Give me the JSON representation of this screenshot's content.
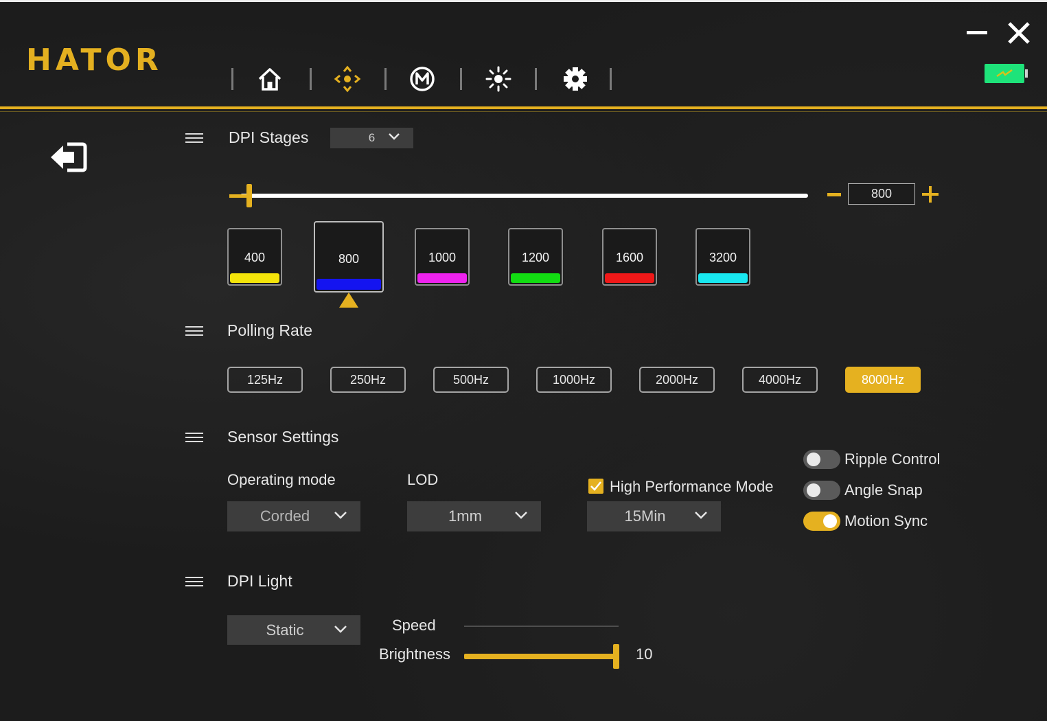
{
  "brand": {
    "logo_text": "HATOR",
    "accent_color": "#e5b120"
  },
  "nav": {
    "tabs": [
      {
        "name": "home",
        "icon": "home-icon"
      },
      {
        "name": "buttons",
        "icon": "crosshair-arrows-icon",
        "active": true
      },
      {
        "name": "macros",
        "icon": "m-circle-icon"
      },
      {
        "name": "lighting",
        "icon": "sun-icon"
      },
      {
        "name": "settings",
        "icon": "gear-icon"
      }
    ]
  },
  "window": {
    "minimize_icon": "minimize-icon",
    "close_icon": "close-icon",
    "battery_icon": "battery-charging-icon"
  },
  "dpi": {
    "title": "DPI Stages",
    "stages_count": "6",
    "current_value": "800",
    "slider_fraction": 0.03,
    "stages": [
      {
        "value": "400",
        "color": "#f4e40a"
      },
      {
        "value": "800",
        "color": "#1414f0",
        "active": true
      },
      {
        "value": "1000",
        "color": "#ee22ee"
      },
      {
        "value": "1200",
        "color": "#12dd12"
      },
      {
        "value": "1600",
        "color": "#f01818"
      },
      {
        "value": "3200",
        "color": "#18e8f0"
      }
    ]
  },
  "polling": {
    "title": "Polling Rate",
    "options": [
      "125Hz",
      "250Hz",
      "500Hz",
      "1000Hz",
      "2000Hz",
      "4000Hz",
      "8000Hz"
    ],
    "selected": "8000Hz"
  },
  "sensor": {
    "title": "Sensor Settings",
    "operating_mode_label": "Operating mode",
    "operating_mode_value": "Corded",
    "lod_label": "LOD",
    "lod_value": "1mm",
    "hpm_label": "High Performance Mode",
    "hpm_checked": true,
    "hpm_value": "15Min",
    "toggles": [
      {
        "label": "Ripple Control",
        "on": false
      },
      {
        "label": "Angle Snap",
        "on": false
      },
      {
        "label": "Motion Sync",
        "on": true
      }
    ]
  },
  "dpi_light": {
    "title": "DPI Light",
    "mode": "Static",
    "speed_label": "Speed",
    "brightness_label": "Brightness",
    "brightness_value": "10"
  }
}
